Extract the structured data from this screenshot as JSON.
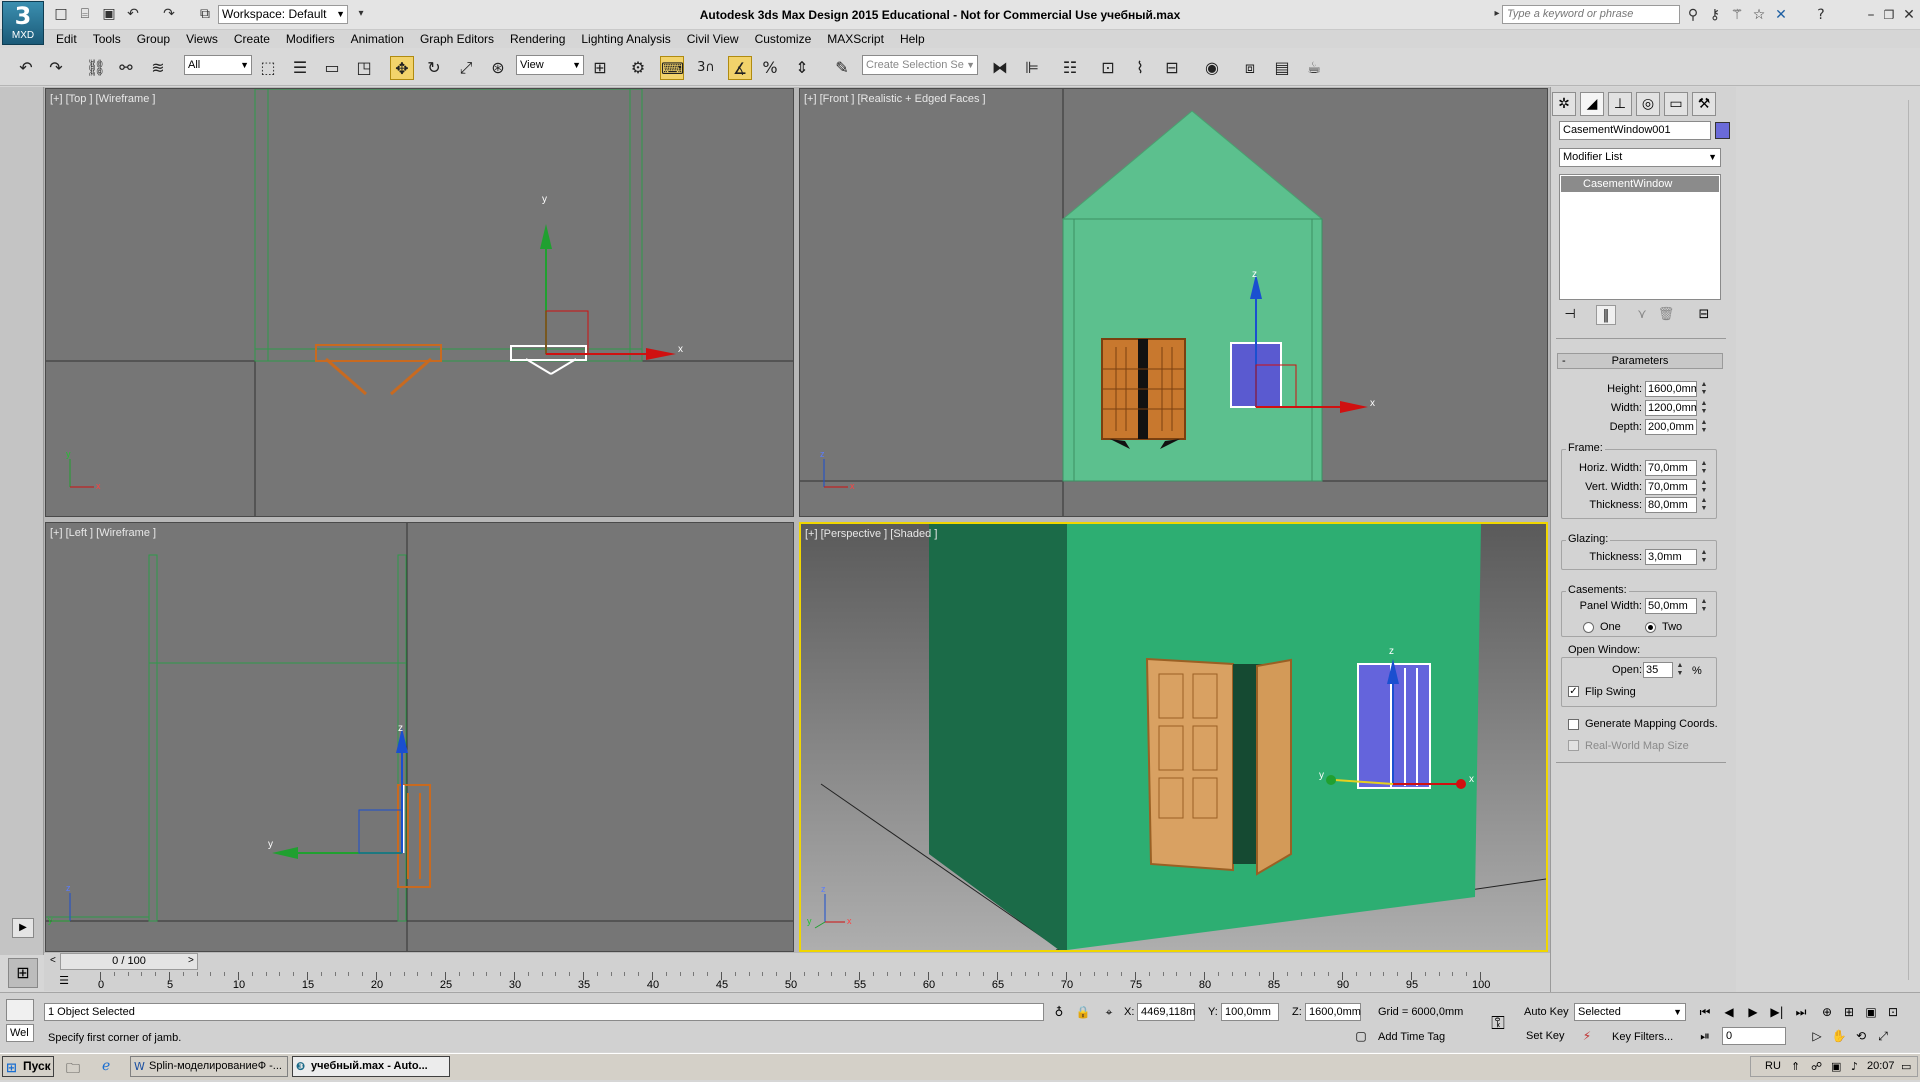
{
  "app": {
    "title": "Autodesk 3ds Max Design 2015  Educational - Not for Commercial Use   учебный.max",
    "icon_label": "MXD",
    "workspace": "Workspace: Default",
    "search_placeholder": "Type a keyword or phrase"
  },
  "menu": [
    "Edit",
    "Tools",
    "Group",
    "Views",
    "Create",
    "Modifiers",
    "Animation",
    "Graph Editors",
    "Rendering",
    "Lighting Analysis",
    "Civil View",
    "Customize",
    "MAXScript",
    "Help"
  ],
  "toolbar": {
    "filter": "All",
    "ref_coord": "View",
    "selection_set_placeholder": "Create Selection Se",
    "snap_label": "3"
  },
  "viewports": {
    "top": "[+] [Top ] [Wireframe ]",
    "front": "[+] [Front ] [Realistic + Edged Faces ]",
    "left": "[+] [Left ] [Wireframe ]",
    "perspective": "[+] [Perspective ] [Shaded ]"
  },
  "axis_labels": {
    "x": "x",
    "y": "y",
    "z": "z"
  },
  "command_panel": {
    "object_name": "CasementWindow001",
    "object_color": "#6a6ad8",
    "modifier_list": "Modifier List",
    "stack_item": "CasementWindow",
    "rollout_title": "Parameters",
    "rollout_toggle": "-",
    "height_label": "Height:",
    "height_value": "1600,0mm",
    "width_label": "Width:",
    "width_value": "1200,0mm",
    "depth_label": "Depth:",
    "depth_value": "200,0mm",
    "frame_group": "Frame:",
    "horiz_width_label": "Horiz. Width:",
    "horiz_width_value": "70,0mm",
    "vert_width_label": "Vert. Width:",
    "vert_width_value": "70,0mm",
    "frame_thickness_label": "Thickness:",
    "frame_thickness_value": "80,0mm",
    "glazing_group": "Glazing:",
    "glazing_thickness_label": "Thickness:",
    "glazing_thickness_value": "3,0mm",
    "casements_group": "Casements:",
    "panel_width_label": "Panel Width:",
    "panel_width_value": "50,0mm",
    "radio_one": "One",
    "radio_two": "Two",
    "open_window_group": "Open Window:",
    "open_label": "Open:",
    "open_value": "35",
    "open_unit": "%",
    "flip_swing": "Flip Swing",
    "flip_swing_checked": true,
    "generate_mapping": "Generate Mapping Coords.",
    "real_world_map": "Real-World Map Size"
  },
  "timeline": {
    "slider": "0 / 100",
    "ticks": [
      "0",
      "5",
      "10",
      "15",
      "20",
      "25",
      "30",
      "35",
      "40",
      "45",
      "50",
      "55",
      "60",
      "65",
      "70",
      "75",
      "80",
      "85",
      "90",
      "95",
      "100"
    ]
  },
  "status": {
    "selected": "1 Object Selected",
    "prompt": "Specify first corner of jamb.",
    "script_label": "Wel",
    "x_label": "X:",
    "x_value": "4469,118m",
    "y_label": "Y:",
    "y_value": "100,0mm",
    "z_label": "Z:",
    "z_value": "1600,0mm",
    "grid": "Grid = 6000,0mm",
    "auto_key": "Auto Key",
    "set_key": "Set Key",
    "key_mode": "Selected",
    "key_filters": "Key Filters...",
    "add_time_tag": "Add Time Tag",
    "frame": "0"
  },
  "taskbar": {
    "start": "Пуск",
    "task1": "Splin-моделированиеФ -...",
    "task2": "учебный.max - Auto...",
    "lang": "RU",
    "time": "20:07"
  }
}
